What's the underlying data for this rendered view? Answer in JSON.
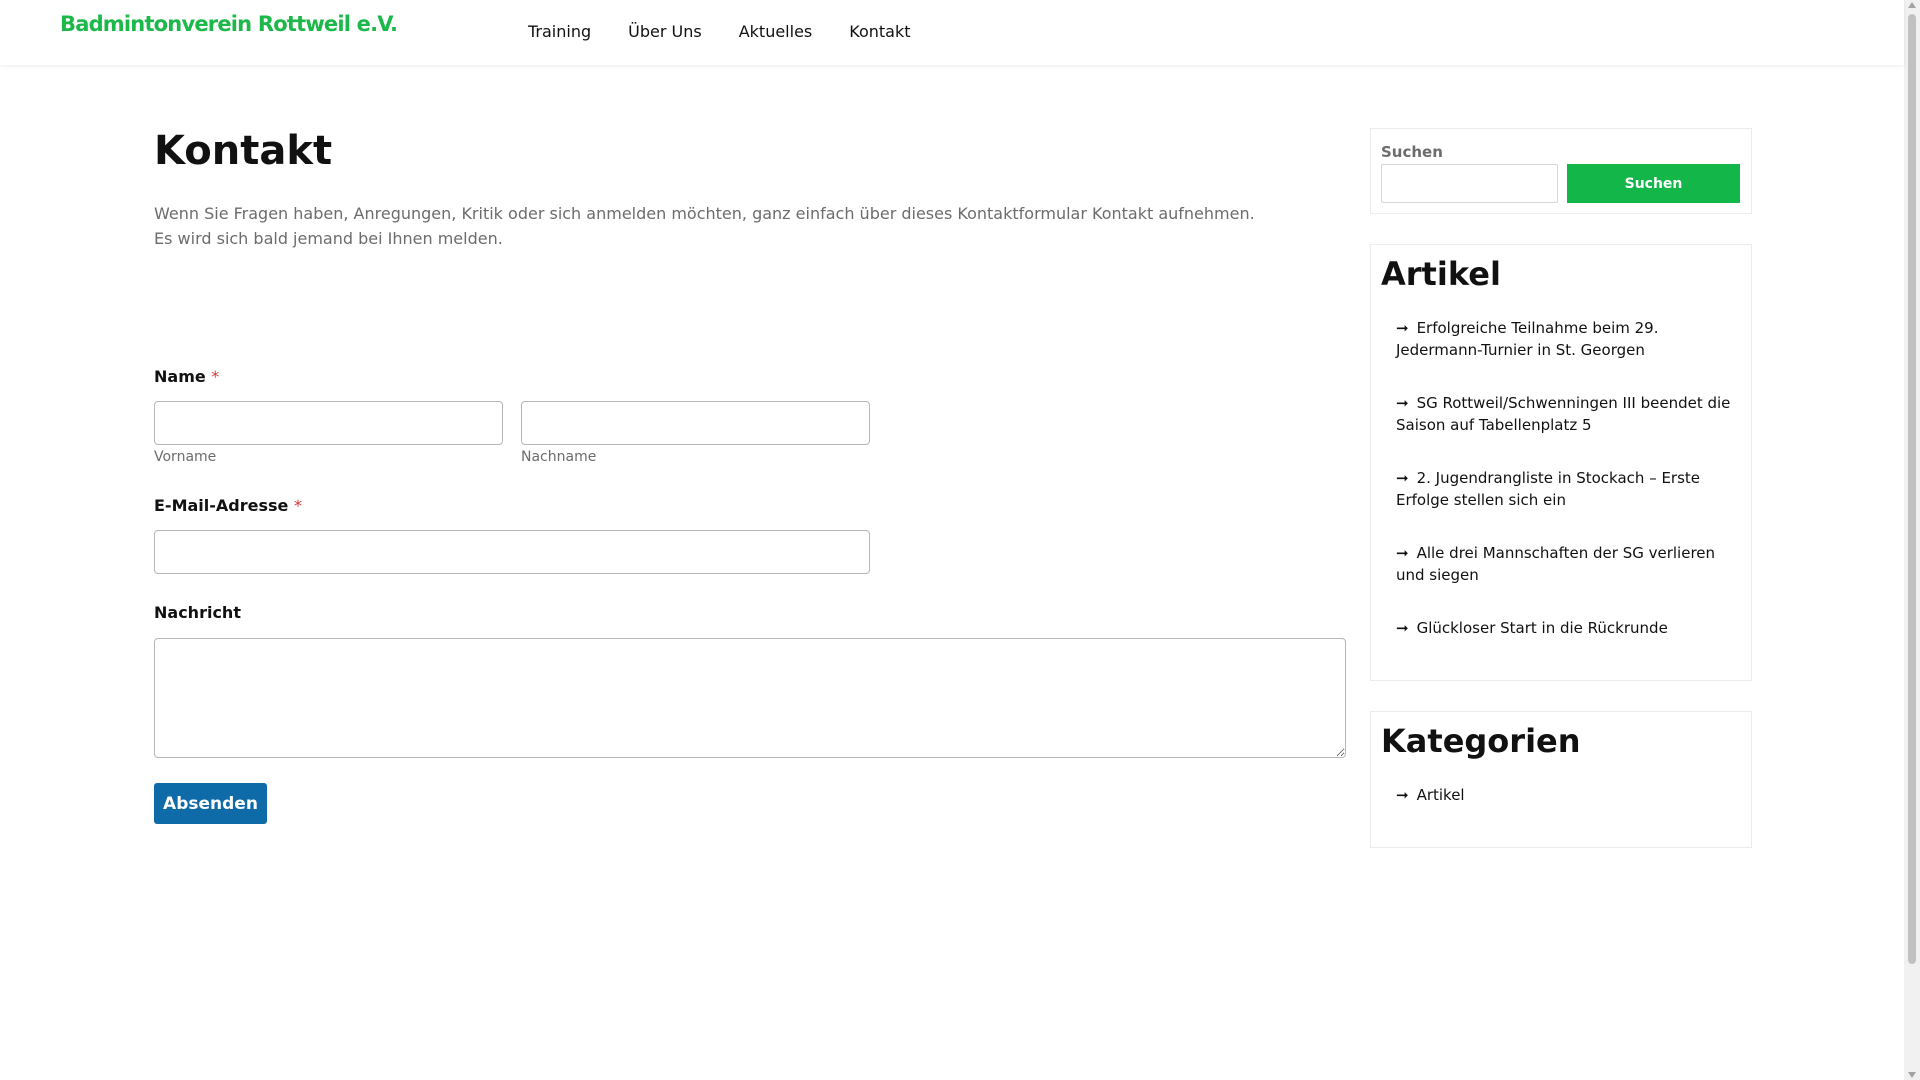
{
  "header": {
    "site_title": "Badmintonverein Rottweil e.V.",
    "nav": [
      {
        "label": "Training"
      },
      {
        "label": "Über Uns"
      },
      {
        "label": "Aktuelles"
      },
      {
        "label": "Kontakt"
      }
    ]
  },
  "main": {
    "title": "Kontakt",
    "intro_line1": "Wenn Sie Fragen haben, Anregungen, Kritik oder sich anmelden möchten, ganz einfach über dieses Kontaktformular Kontakt aufnehmen.",
    "intro_line2": "Es wird sich bald jemand bei Ihnen melden."
  },
  "form": {
    "name_label": "Name",
    "required_marker": "*",
    "first_name_value": "",
    "first_name_sublabel": "Vorname",
    "last_name_value": "",
    "last_name_sublabel": "Nachname",
    "email_label": "E-Mail-Adresse",
    "email_value": "",
    "message_label": "Nachricht",
    "message_value": "",
    "submit_label": "Absenden"
  },
  "sidebar": {
    "search": {
      "label": "Suchen",
      "value": "",
      "button_label": "Suchen"
    },
    "articles": {
      "title": "Artikel",
      "items": [
        {
          "label": "Erfolgreiche Teilnahme beim 29. Jedermann-Turnier in St. Georgen"
        },
        {
          "label": "SG Rottweil/Schwenningen III beendet die Saison auf Tabellenplatz 5"
        },
        {
          "label": "2. Jugendrangliste in Stockach – Erste Erfolge stellen sich ein"
        },
        {
          "label": "Alle drei Mannschaften der SG verlieren und siegen"
        },
        {
          "label": "Glückloser Start in die Rückrunde"
        }
      ]
    },
    "categories": {
      "title": "Kategorien",
      "items": [
        {
          "label": "Artikel"
        }
      ]
    },
    "arrow_glyph": "➞"
  },
  "colors": {
    "brand_green": "#1cb84a",
    "submit_blue": "#0f6aa8",
    "search_green": "#13b749",
    "required_red": "#d63638"
  }
}
